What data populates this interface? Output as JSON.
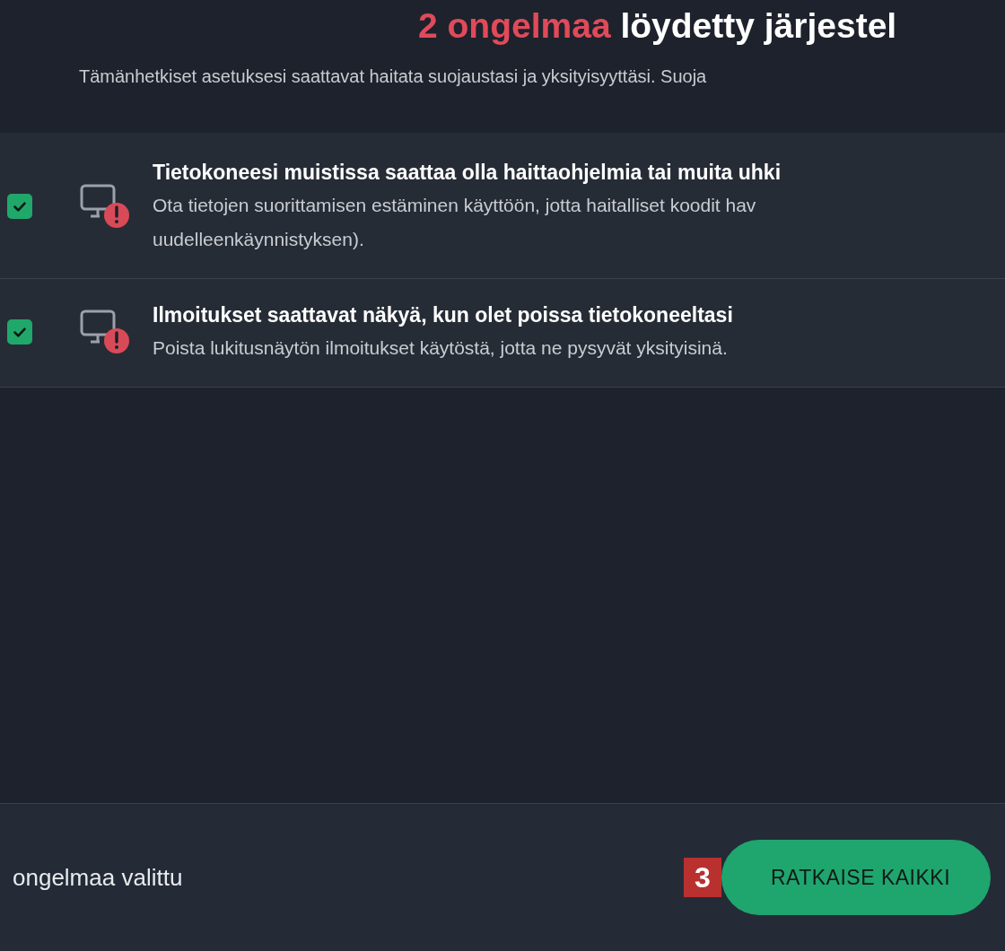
{
  "header": {
    "title_count": "2 ongelmaa",
    "title_rest": "löydetty järjestel",
    "subtitle": "Tämänhetkiset asetuksesi saattavat haitata suojaustasi ja yksityisyyttäsi. Suoja"
  },
  "issues": [
    {
      "title": "Tietokoneesi muistissa saattaa olla haittaohjelmia tai muita uhki",
      "description_lines": [
        "Ota tietojen suorittamisen estäminen käyttöön, jotta haitalliset koodit hav",
        "uudelleenkäynnistyksen)."
      ],
      "checked": true
    },
    {
      "title": "Ilmoitukset saattavat näkyä, kun olet poissa tietokoneeltasi",
      "description_lines": [
        "Poista lukitusnäytön ilmoitukset käytöstä, jotta ne pysyvät yksityisinä."
      ],
      "checked": true
    }
  ],
  "footer": {
    "selected_text": "ongelmaa valittu",
    "callout": "3",
    "button": "RATKAISE KAIKKI"
  }
}
